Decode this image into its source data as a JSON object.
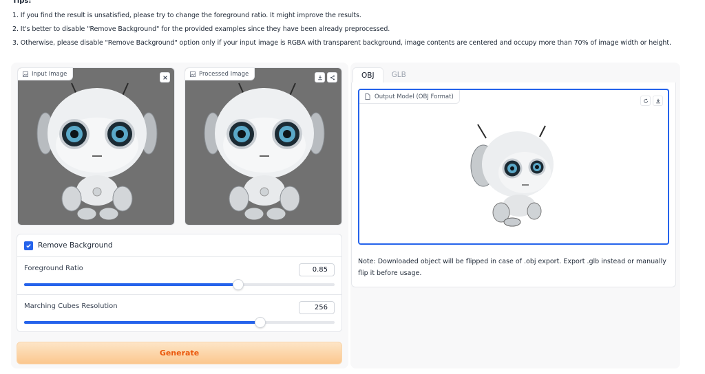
{
  "tips": {
    "title": "Tips:",
    "items": [
      "1. If you find the result is unsatisfied, please try to change the foreground ratio. It might improve the results.",
      "2. It's better to disable \"Remove Background\" for the provided examples since they have been already preprocessed.",
      "3. Otherwise, please disable \"Remove Background\" option only if your input image is RGBA with transparent background, image contents are centered and occupy more than 70% of image width or height."
    ]
  },
  "input_image": {
    "label": "Input Image",
    "label_icon": "image-icon",
    "close_icon": "close-icon"
  },
  "processed_image": {
    "label": "Processed Image",
    "label_icon": "image-icon",
    "download_icon": "download-icon",
    "share_icon": "share-icon"
  },
  "controls": {
    "remove_background": {
      "label": "Remove Background",
      "checked": true
    },
    "foreground_ratio": {
      "label": "Foreground Ratio",
      "value": "0.85",
      "fraction": 0.69
    },
    "marching_cubes": {
      "label": "Marching Cubes Resolution",
      "value": "256",
      "fraction": 0.76
    }
  },
  "generate_button": {
    "label": "Generate"
  },
  "tabs": [
    {
      "label": "OBJ",
      "active": true
    },
    {
      "label": "GLB",
      "active": false
    }
  ],
  "output_model": {
    "label": "Output Model (OBJ Format)",
    "label_icon": "file-icon",
    "reset_icon": "reset-icon",
    "download_icon": "download-icon"
  },
  "note": "Note: Downloaded object will be flipped in case of .obj export. Export .glb instead or manually flip it before usage.",
  "colors": {
    "accent": "#2563eb",
    "generate_text": "#ea580c",
    "image_bg": "#717171"
  }
}
